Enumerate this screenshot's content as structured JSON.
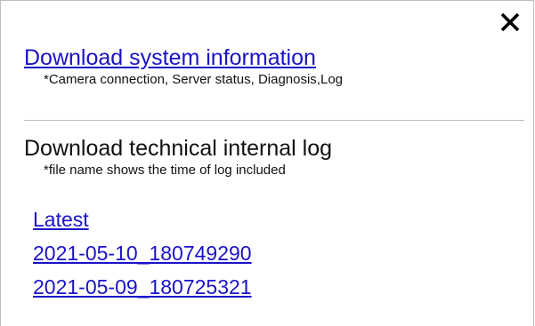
{
  "dialog": {
    "close_icon": "close-icon",
    "system_info": {
      "link_label": "Download system information",
      "note": "*Camera connection, Server status, Diagnosis,Log"
    },
    "internal_log": {
      "heading": "Download technical internal log",
      "note": "*file name shows the time of log included",
      "files": [
        "Latest",
        "2021-05-10_180749290",
        "2021-05-09_180725321"
      ]
    },
    "colors": {
      "link": "#1a13c8",
      "text": "#111111",
      "divider": "#bdbdbd"
    }
  }
}
